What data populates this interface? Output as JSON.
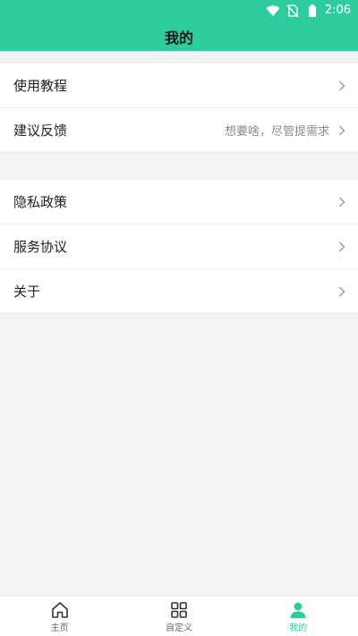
{
  "status_bar": {
    "time": "2:06",
    "icons": [
      "wifi-icon",
      "no-sim-icon",
      "battery-icon"
    ]
  },
  "header": {
    "title": "我的"
  },
  "menu_group_1": [
    {
      "label": "使用教程",
      "hint": ""
    },
    {
      "label": "建议反馈",
      "hint": "想要啥，尽管提需求"
    }
  ],
  "menu_group_2": [
    {
      "label": "隐私政策",
      "hint": ""
    },
    {
      "label": "服务协议",
      "hint": ""
    },
    {
      "label": "关于",
      "hint": ""
    }
  ],
  "tabbar": {
    "tabs": [
      {
        "label": "主页",
        "icon": "home-icon",
        "active": false
      },
      {
        "label": "自定义",
        "icon": "grid-icon",
        "active": false
      },
      {
        "label": "我的",
        "icon": "user-icon",
        "active": true
      }
    ]
  },
  "colors": {
    "accent": "#2ecc9a",
    "background": "#f2f3f5",
    "text": "#222222",
    "hint": "#8a8a8a"
  }
}
